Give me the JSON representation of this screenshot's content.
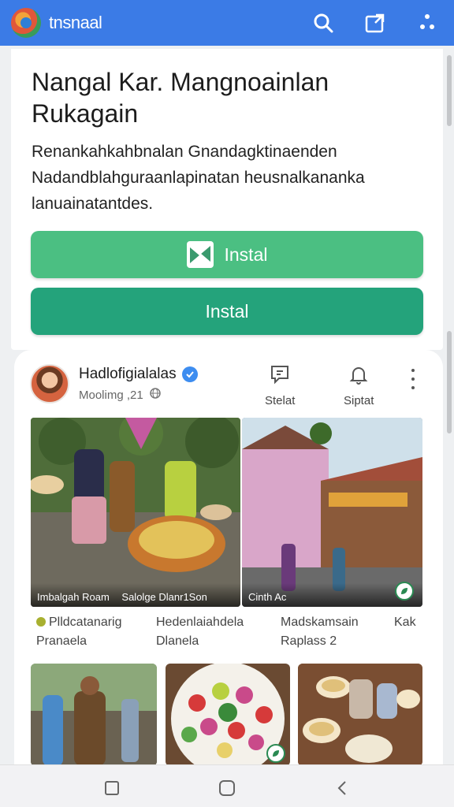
{
  "app": {
    "name": "tnsnaal"
  },
  "card": {
    "title": "Nangal Kar. Mangnoainlan Rukagain",
    "description": "Renankahkahbnalan Gnandagktinaenden Nadandblahguraanlapinatan heusnalkananka lanuainatantdes.",
    "primary_button": "Instal",
    "secondary_button": "Instal"
  },
  "post": {
    "author": "Hadlofigialalas",
    "meta": "Moolimg ,21",
    "actions": [
      {
        "label": "Stelat"
      },
      {
        "label": "Siptat"
      }
    ],
    "photo_captions": [
      "Imbalgah Roam",
      "Salolge Dlanr1Son",
      "Cinth Ac"
    ],
    "captions": [
      "Plldcatanarig Pranaela",
      "Hedenlaiahdela Dlanela",
      "Madskamsain Raplass 2",
      "Kak"
    ]
  },
  "colors": {
    "topbar": "#3b7be6",
    "install_primary": "#4bbf82",
    "install_secondary": "#24a37b"
  }
}
